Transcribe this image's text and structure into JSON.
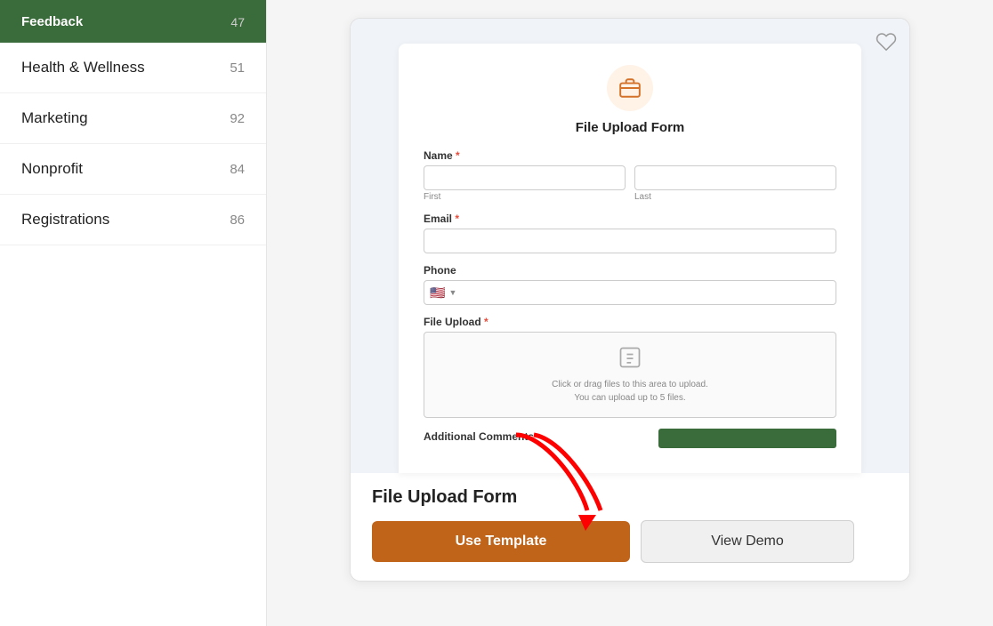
{
  "sidebar": {
    "top": {
      "label": "Feedback",
      "count": "47"
    },
    "items": [
      {
        "id": "health-wellness",
        "label": "Health & Wellness",
        "count": "51",
        "active": false
      },
      {
        "id": "marketing",
        "label": "Marketing",
        "count": "92",
        "active": false
      },
      {
        "id": "nonprofit",
        "label": "Nonprofit",
        "count": "84",
        "active": false
      },
      {
        "id": "registrations",
        "label": "Registrations",
        "count": "86",
        "active": false
      }
    ]
  },
  "template_card": {
    "form": {
      "icon_alt": "briefcase-icon",
      "title": "File Upload Form",
      "fields": [
        {
          "label": "Name",
          "required": true,
          "type": "double",
          "sub_labels": [
            "First",
            "Last"
          ]
        },
        {
          "label": "Email",
          "required": true,
          "type": "single"
        },
        {
          "label": "Phone",
          "required": false,
          "type": "phone"
        },
        {
          "label": "File Upload",
          "required": true,
          "type": "upload",
          "upload_text_1": "Click or drag files to this area to upload.",
          "upload_text_2": "You can upload up to 5 files."
        },
        {
          "label": "Additional Comments",
          "required": false,
          "type": "comments"
        }
      ]
    },
    "name": "File Upload Form",
    "actions": {
      "use_template": "Use Template",
      "view_demo": "View Demo"
    }
  },
  "icons": {
    "heart": "♡",
    "upload": "📤",
    "briefcase": "💼",
    "flag_us": "🇺🇸"
  }
}
